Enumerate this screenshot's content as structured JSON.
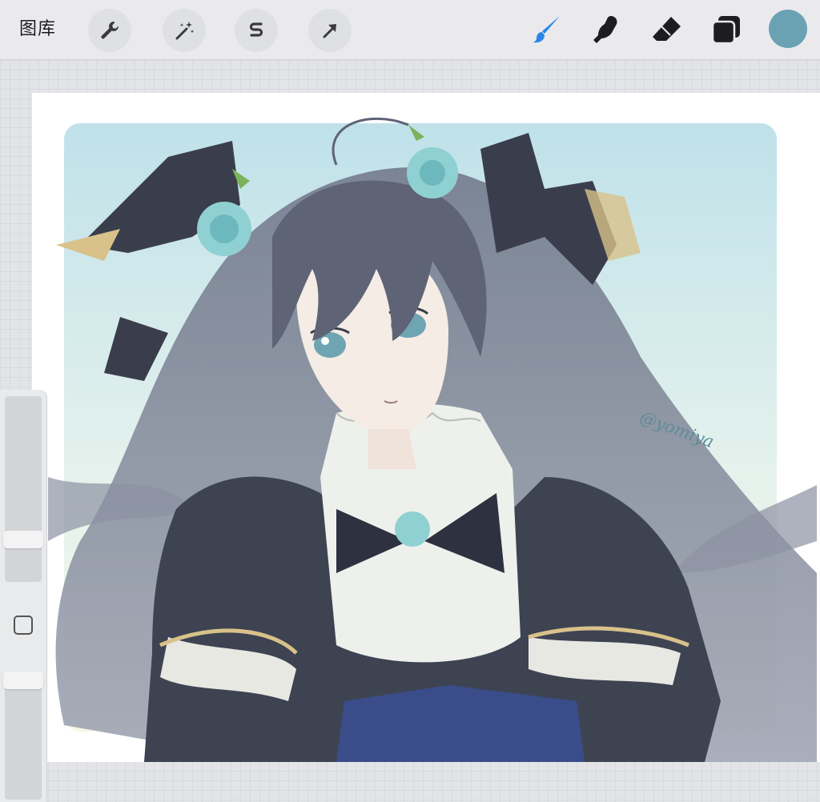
{
  "toolbar": {
    "gallery_label": "图库",
    "left_tools": [
      "actions-wrench",
      "adjustments-magic-wand",
      "selection-s",
      "transform-arrow"
    ],
    "right_tools": [
      "brush",
      "smudge",
      "eraser",
      "layers"
    ],
    "current_color": "#6aa2b4",
    "brush_color": "#2a86e8"
  },
  "canvas": {
    "signature": "@yomiya"
  },
  "sidebar": {
    "controls": [
      "brush-size-slider",
      "modify-button",
      "opacity-slider"
    ]
  }
}
